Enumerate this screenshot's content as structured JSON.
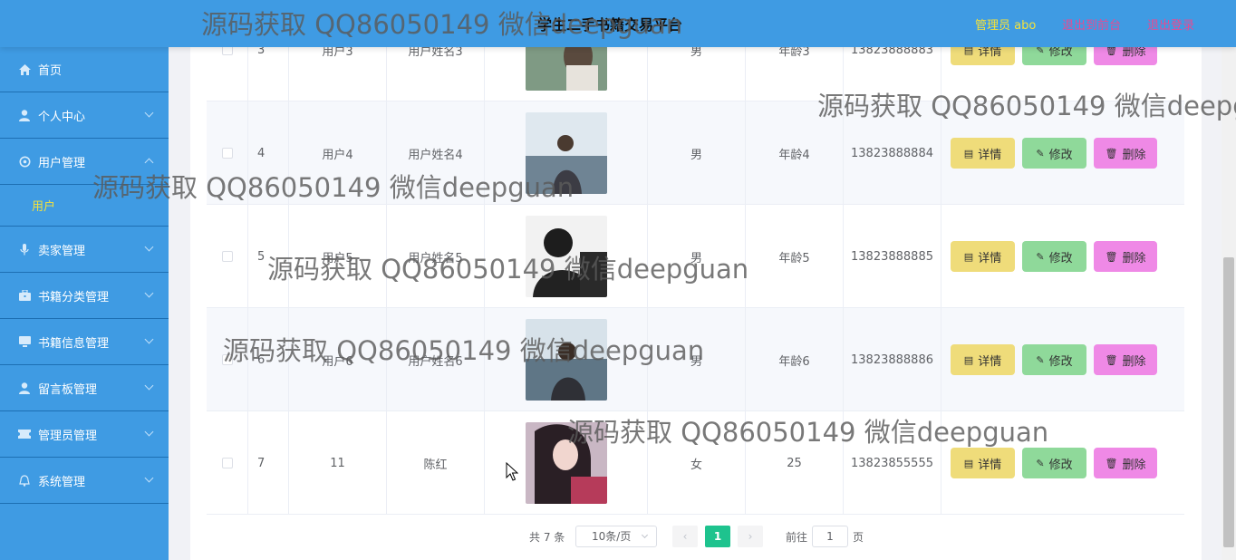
{
  "header": {
    "title": "学生二手书籍交易平台",
    "admin_label": "管理员 abo",
    "back_front": "退出到前台",
    "logout": "退出登录"
  },
  "sidebar": {
    "items": [
      {
        "label": "首页",
        "icon": "home-icon"
      },
      {
        "label": "个人中心",
        "icon": "user-icon"
      },
      {
        "label": "用户管理",
        "icon": "gear-icon"
      },
      {
        "label": "卖家管理",
        "icon": "microphone-icon"
      },
      {
        "label": "书籍分类管理",
        "icon": "briefcase-icon"
      },
      {
        "label": "书籍信息管理",
        "icon": "monitor-icon"
      },
      {
        "label": "留言板管理",
        "icon": "user-icon"
      },
      {
        "label": "管理员管理",
        "icon": "ticket-icon"
      },
      {
        "label": "系统管理",
        "icon": "bell-icon"
      }
    ],
    "submenu": {
      "label": "用户"
    }
  },
  "table": {
    "rows": [
      {
        "index": "3",
        "account": "用户3",
        "name": "用户姓名3",
        "gender": "男",
        "age": "年龄3",
        "phone": "13823888883"
      },
      {
        "index": "4",
        "account": "用户4",
        "name": "用户姓名4",
        "gender": "男",
        "age": "年龄4",
        "phone": "13823888884"
      },
      {
        "index": "5",
        "account": "用户5",
        "name": "用户姓名5",
        "gender": "男",
        "age": "年龄5",
        "phone": "13823888885"
      },
      {
        "index": "6",
        "account": "用户6",
        "name": "用户姓名6",
        "gender": "男",
        "age": "年龄6",
        "phone": "13823888886"
      },
      {
        "index": "7",
        "account": "11",
        "name": "陈红",
        "gender": "女",
        "age": "25",
        "phone": "13823855555"
      }
    ],
    "actions": {
      "detail": "详情",
      "edit": "修改",
      "delete": "删除"
    }
  },
  "pagination": {
    "total": "共 7 条",
    "page_size": "10条/页",
    "current": "1",
    "goto_label": "前往",
    "goto_value": "1",
    "page_label": "页"
  },
  "watermark": "源码获取 QQ86050149 微信deepguan",
  "colors": {
    "header": "#3f9be3",
    "sidebar": "#3f9be3",
    "active_submenu": "#f5e23a",
    "detail_button": "#efdc7a",
    "edit_button": "#8fd99a",
    "delete_button": "#ef89e6",
    "current_page": "#1ec38e"
  }
}
